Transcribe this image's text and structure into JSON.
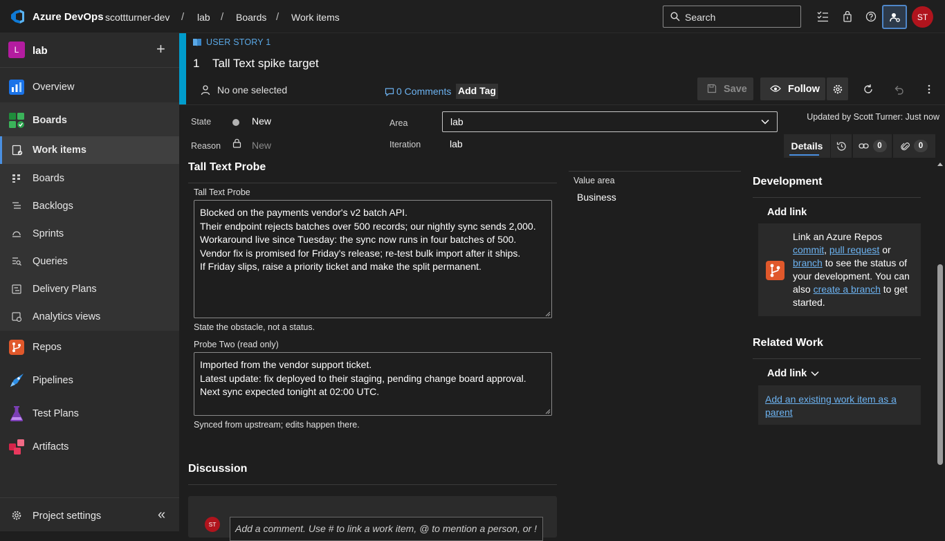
{
  "topbar": {
    "brand": "Azure DevOps",
    "breadcrumbs": [
      "scottturner-dev",
      "lab",
      "Boards",
      "Work items"
    ],
    "separator": "/",
    "search_placeholder": "Search",
    "user_initials": "ST"
  },
  "sidebar": {
    "project_initial": "L",
    "project_name": "lab",
    "add_symbol": "+",
    "items": [
      {
        "label": "Overview",
        "icon": "overview-icon"
      },
      {
        "label": "Boards",
        "icon": "boards-icon"
      },
      {
        "label": "Work items",
        "icon": "work-items-icon"
      },
      {
        "label": "Boards",
        "icon": "kanban-icon"
      },
      {
        "label": "Backlogs",
        "icon": "backlogs-icon"
      },
      {
        "label": "Sprints",
        "icon": "sprints-icon"
      },
      {
        "label": "Queries",
        "icon": "queries-icon"
      },
      {
        "label": "Delivery Plans",
        "icon": "delivery-plans-icon"
      },
      {
        "label": "Analytics views",
        "icon": "analytics-icon"
      },
      {
        "label": "Repos",
        "icon": "repos-icon"
      },
      {
        "label": "Pipelines",
        "icon": "pipelines-icon"
      },
      {
        "label": "Test Plans",
        "icon": "test-plans-icon"
      },
      {
        "label": "Artifacts",
        "icon": "artifacts-icon"
      }
    ],
    "settings_label": "Project settings",
    "collapse_symbol": "«"
  },
  "work_item": {
    "type_label": "USER STORY 1",
    "id": "1",
    "title": "Tall Text spike target",
    "assignee": "No one selected",
    "comments": "0 Comments",
    "add_tag": "Add Tag",
    "save": "Save",
    "follow": "Follow",
    "updated": "Updated by Scott Turner: Just now"
  },
  "fields": {
    "state_label": "State",
    "state_value": "New",
    "reason_label": "Reason",
    "reason_value": "New",
    "area_label": "Area",
    "area_value": "lab",
    "iteration_label": "Iteration",
    "iteration_value": "lab"
  },
  "tabs": {
    "details": "Details",
    "links_count": "0",
    "attachments_count": "0"
  },
  "content": {
    "section_title": "Tall Text Probe",
    "probe_label": "Tall Text Probe",
    "probe_lines": [
      "Blocked on the payments vendor's v2 batch API.",
      "Their endpoint rejects batches over 500 records; our nightly sync sends 2,000.",
      "Workaround live since Tuesday: the sync now runs in four batches of 500.",
      "Vendor fix is promised for Friday's release; re-test bulk import after it ships.",
      "If Friday slips, raise a priority ticket and make the split permanent."
    ],
    "probe_hint": "State the obstacle, not a status.",
    "probe2_label": "Probe Two (read only)",
    "probe2_lines": [
      "Imported from the vendor support ticket.",
      "Latest update: fix deployed to their staging, pending change board approval.",
      "Next sync expected tonight at 02:00 UTC."
    ],
    "probe2_hint": "Synced from upstream; edits happen there.",
    "value_area_label": "Value area",
    "value_area_value": "Business",
    "discussion_title": "Discussion",
    "discussion_placeholder": "Add a comment. Use # to link a work item, @ to mention a person, or !",
    "discussion_initials": "ST"
  },
  "development": {
    "title": "Development",
    "add_link": "Add link",
    "text_1": "Link an Azure Repos",
    "link_commit": "commit",
    "comma": ",",
    "link_pr": "pull request",
    "or": "or",
    "link_branch": "branch",
    "text_2": "to see the status of your development. You can also",
    "link_create_branch": "create a branch",
    "text_3": "to get started."
  },
  "related": {
    "title": "Related Work",
    "add_link": "Add link",
    "add_parent": "Add an existing work item as a parent"
  },
  "colors": {
    "accent": "#009ccc",
    "link": "#6cb2f0",
    "avatar": "#b0141d",
    "project": "#b31ca0"
  }
}
